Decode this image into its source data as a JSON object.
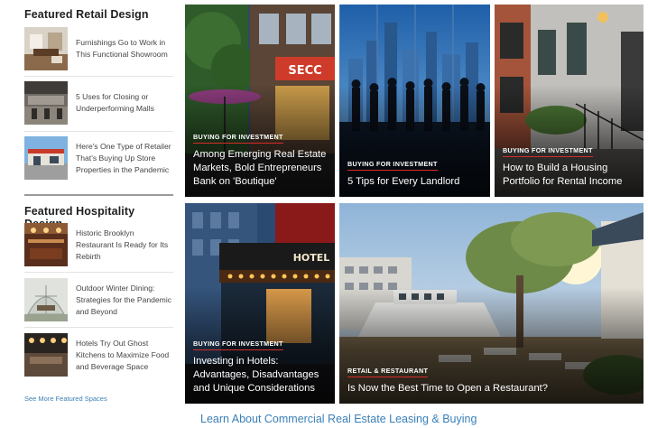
{
  "sidebar": {
    "retail": {
      "title": "Featured Retail Design",
      "items": [
        {
          "text": "Furnishings Go to Work in This Functional Showroom"
        },
        {
          "text": "5 Uses for Closing or Underperforming Malls"
        },
        {
          "text": "Here's One Type of Retailer That's Buying Up Store Properties in the Pandemic"
        }
      ]
    },
    "hospitality": {
      "title": "Featured Hospitality Design",
      "items": [
        {
          "text": "Historic Brooklyn Restaurant Is Ready for Its Rebirth"
        },
        {
          "text": "Outdoor Winter Dining: Strategies for the Pandemic and Beyond"
        },
        {
          "text": "Hotels Try Out Ghost Kitchens to Maximize Food and Beverage Space"
        }
      ]
    },
    "see_more": "See More Featured Spaces"
  },
  "cards": [
    {
      "category": "BUYING FOR INVESTMENT",
      "headline": "Among Emerging Real Estate Markets, Bold Entrepreneurs Bank on 'Boutique'",
      "sign_text": "SECC"
    },
    {
      "category": "BUYING FOR INVESTMENT",
      "headline": "5 Tips for Every Landlord"
    },
    {
      "category": "BUYING FOR INVESTMENT",
      "headline": "How to Build a Housing Portfolio for Rental Income"
    },
    {
      "category": "BUYING FOR INVESTMENT",
      "headline": "Investing in Hotels: Advantages, Disadvantages and Unique Considerations",
      "sign_text": "HOTEL"
    },
    {
      "category": "RETAIL & RESTAURANT",
      "headline": "Is Now the Best Time to Open a Restaurant?"
    }
  ],
  "footer": {
    "link": "Learn About Commercial Real Estate Leasing & Buying"
  },
  "colors": {
    "accent_red": "#d62b2b",
    "link_blue": "#3a7fb7"
  }
}
